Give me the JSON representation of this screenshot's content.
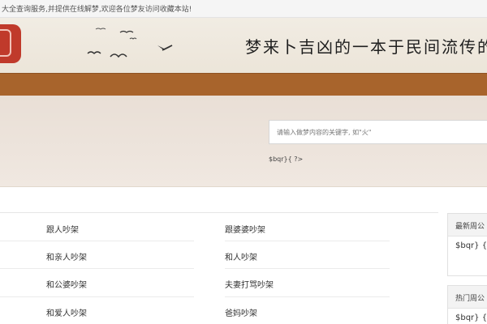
{
  "topbar": {
    "text": "大全查询服务,并提供在线解梦,欢迎各位梦友访问收藏本站!"
  },
  "header": {
    "slogan": "梦来卜吉凶的一本于民间流传的解"
  },
  "search": {
    "placeholder": "请输入做梦内容的关键字, 如\"火\"",
    "hot_code": "$bqr}{ ?>"
  },
  "list": {
    "col2": [
      "跟人吵架",
      "和亲人吵架",
      "和公婆吵架",
      "和爱人吵架"
    ],
    "col3": [
      "跟婆婆吵架",
      "和人吵架",
      "夫妻打骂吵架",
      "爸妈吵架"
    ]
  },
  "sidebar": {
    "latest": {
      "title": "最新周公",
      "body": "$bqr} {"
    },
    "hot": {
      "title": "热门周公",
      "body": "$bqr} {"
    }
  },
  "colors": {
    "nav_brown": "#a8642c",
    "seal_red": "#c03a2b",
    "hero_beige": "#ece3da"
  }
}
